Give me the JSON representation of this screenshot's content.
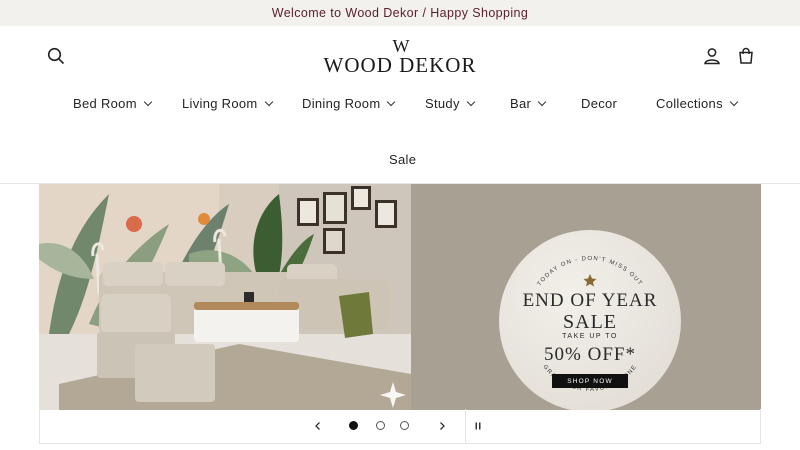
{
  "announcement": {
    "text": "Welcome to Wood Dekor / Happy Shopping"
  },
  "header": {
    "logo": {
      "mark": "W",
      "wordmark": "WOOD DEKOR"
    },
    "icons": {
      "search": "search-icon",
      "account": "account-icon",
      "cart": "cart-icon"
    }
  },
  "nav": {
    "items": [
      {
        "label": "Bed Room",
        "dropdown": true
      },
      {
        "label": "Living Room",
        "dropdown": true
      },
      {
        "label": "Dining Room",
        "dropdown": true
      },
      {
        "label": "Study",
        "dropdown": true
      },
      {
        "label": "Bar",
        "dropdown": true
      },
      {
        "label": "Decor",
        "dropdown": false
      },
      {
        "label": "Collections",
        "dropdown": true
      },
      {
        "label": "Sale",
        "dropdown": false
      }
    ]
  },
  "hero": {
    "badge": {
      "arc_top": "TODAY ON - DON'T MISS OUT",
      "line1": "END OF YEAR",
      "line2": "SALE",
      "line3": "TAKE UP TO",
      "line4": "50% OFF*",
      "cta": "SHOP NOW",
      "arc_bottom": "GRAB YOUR FAVORITE ONE"
    },
    "colors": {
      "panel": "#a8a193",
      "badge": "#ebe7e0"
    }
  },
  "slider": {
    "slide_count": 3,
    "active_slide": 1,
    "icons": {
      "prev": "chevron-left-icon",
      "next": "chevron-right-icon",
      "pause": "pause-icon"
    }
  },
  "colors": {
    "announcement_bg": "#f3f1ee",
    "announcement_text": "#5a1f2a"
  }
}
